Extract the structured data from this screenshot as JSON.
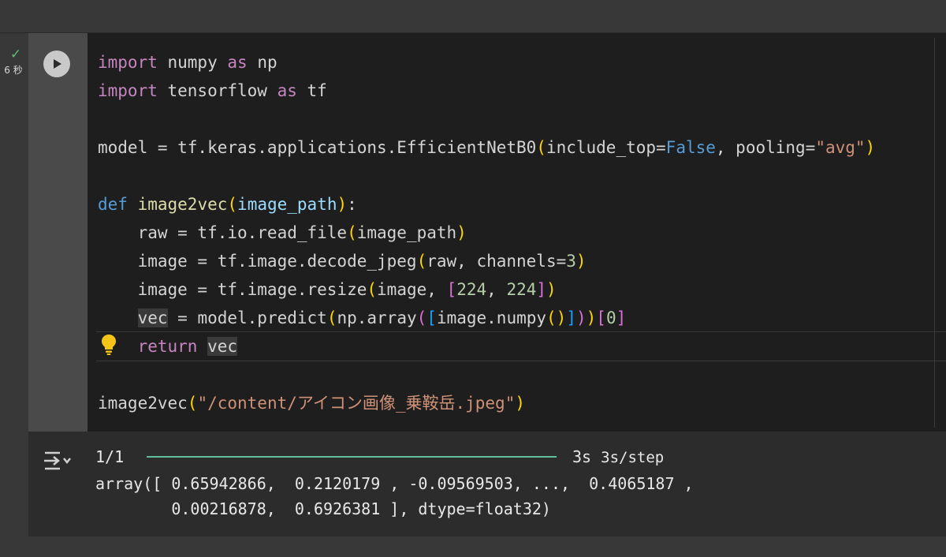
{
  "status": {
    "check_glyph": "✓",
    "exec_time": "6 秒"
  },
  "code": {
    "lines": [
      [
        [
          "kw",
          "import"
        ],
        [
          "",
          " numpy "
        ],
        [
          "kw",
          "as"
        ],
        [
          "",
          " np"
        ]
      ],
      [
        [
          "kw",
          "import"
        ],
        [
          "",
          " tensorflow "
        ],
        [
          "kw",
          "as"
        ],
        [
          "",
          " tf"
        ]
      ],
      [],
      [
        [
          "",
          "model = tf.keras.applications.EfficientNetB0"
        ],
        [
          "b1",
          "("
        ],
        [
          "",
          "include_top="
        ],
        [
          "const",
          "False"
        ],
        [
          "",
          ", pooling="
        ],
        [
          "str",
          "\"avg\""
        ],
        [
          "b1",
          ")"
        ]
      ],
      [],
      [
        [
          "kw2",
          "def"
        ],
        [
          "",
          " "
        ],
        [
          "fn",
          "image2vec"
        ],
        [
          "b1",
          "("
        ],
        [
          "param",
          "image_path"
        ],
        [
          "b1",
          ")"
        ],
        [
          "",
          ":"
        ]
      ],
      [
        [
          "",
          "    raw = tf.io.read_file"
        ],
        [
          "b1",
          "("
        ],
        [
          "",
          "image_path"
        ],
        [
          "b1",
          ")"
        ]
      ],
      [
        [
          "",
          "    image = tf.image.decode_jpeg"
        ],
        [
          "b1",
          "("
        ],
        [
          "",
          "raw, channels="
        ],
        [
          "num",
          "3"
        ],
        [
          "b1",
          ")"
        ]
      ],
      [
        [
          "",
          "    image = tf.image.resize"
        ],
        [
          "b1",
          "("
        ],
        [
          "",
          "image, "
        ],
        [
          "b2",
          "["
        ],
        [
          "num",
          "224"
        ],
        [
          "",
          ", "
        ],
        [
          "num",
          "224"
        ],
        [
          "b2",
          "]"
        ],
        [
          "b1",
          ")"
        ]
      ],
      [
        [
          "",
          "    "
        ],
        [
          "word-hl",
          "vec"
        ],
        [
          "",
          " = model.predict"
        ],
        [
          "b1",
          "("
        ],
        [
          "",
          "np.array"
        ],
        [
          "b2",
          "("
        ],
        [
          "b3",
          "["
        ],
        [
          "",
          "image.numpy"
        ],
        [
          "b1",
          "()"
        ],
        [
          "b3",
          "]"
        ],
        [
          "b2",
          ")"
        ],
        [
          "b1",
          ")"
        ],
        [
          "b2",
          "["
        ],
        [
          "num",
          "0"
        ],
        [
          "b2",
          "]"
        ]
      ],
      [
        [
          "",
          "    "
        ],
        [
          "kw",
          "return"
        ],
        [
          "",
          " "
        ],
        [
          "word-hl",
          "vec"
        ]
      ],
      [],
      [
        [
          "",
          "image2vec"
        ],
        [
          "b1",
          "("
        ],
        [
          "str",
          "\"/content/アイコン画像_乗鞍岳.jpeg\""
        ],
        [
          "b1",
          ")"
        ]
      ]
    ]
  },
  "output": {
    "progress_count": "1/1",
    "progress_fraction": 1.0,
    "time_total": "3s",
    "time_per_step": "3s/step",
    "result_line1": "array([ 0.65942866,  0.2120179 , -0.09569503, ...,  0.4065187 ,",
    "result_line2": "        0.00216878,  0.6926381 ], dtype=float32)"
  },
  "icons": {
    "run": "play-icon",
    "bulb": "lightbulb-icon",
    "output": "output-toggle-icon"
  }
}
